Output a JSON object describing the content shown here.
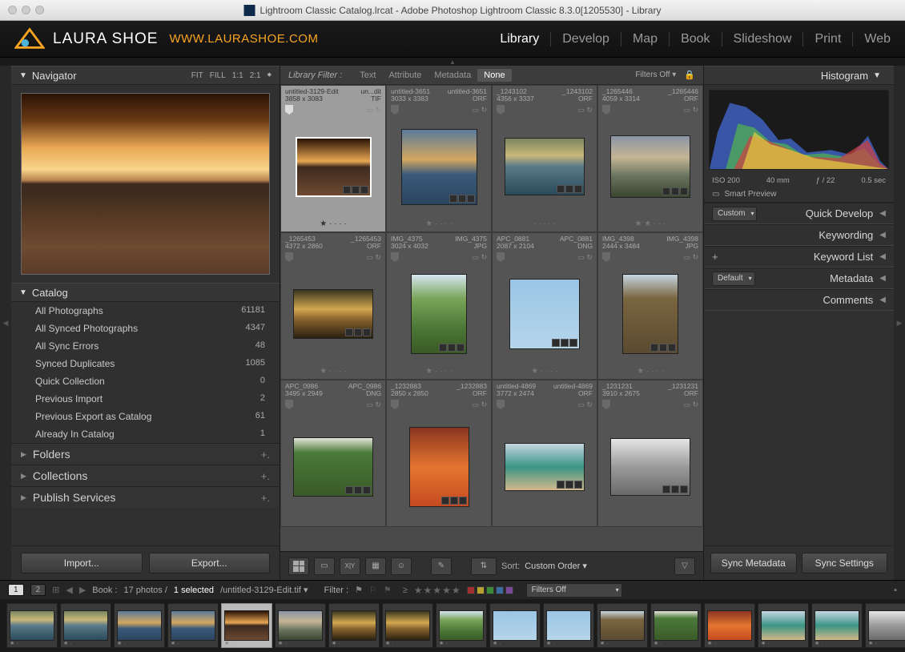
{
  "titlebar": {
    "text": "Lightroom Classic Catalog.lrcat - Adobe Photoshop Lightroom Classic 8.3.0[1205530] - Library"
  },
  "brand": {
    "name": "LAURA SHOE",
    "url": "WWW.LAURASHOE.COM"
  },
  "modules": [
    "Library",
    "Develop",
    "Map",
    "Book",
    "Slideshow",
    "Print",
    "Web"
  ],
  "active_module": "Library",
  "navigator": {
    "title": "Navigator",
    "modes": [
      "FIT",
      "FILL",
      "1:1",
      "2:1"
    ]
  },
  "catalog": {
    "title": "Catalog",
    "rows": [
      {
        "label": "All Photographs",
        "count": "61181"
      },
      {
        "label": "All Synced Photographs",
        "count": "4347"
      },
      {
        "label": "All Sync Errors",
        "count": "48"
      },
      {
        "label": "Synced Duplicates",
        "count": "1085"
      },
      {
        "label": "Quick Collection",
        "count": "0"
      },
      {
        "label": "Previous Import",
        "count": "2"
      },
      {
        "label": "Previous Export as Catalog",
        "count": "61"
      },
      {
        "label": "Already In Catalog",
        "count": "1"
      }
    ]
  },
  "sections": [
    "Folders",
    "Collections",
    "Publish Services"
  ],
  "import_btn": "Import...",
  "export_btn": "Export...",
  "filterbar": {
    "title": "Library Filter :",
    "tabs": [
      "Text",
      "Attribute",
      "Metadata",
      "None"
    ],
    "active": "None",
    "off": "Filters Off"
  },
  "grid": [
    {
      "name1": "untitled-3129-Edit",
      "name2": "un...dit",
      "dim": "3858 x 3083",
      "ext": "TIF",
      "thumb": "t1",
      "sel": true,
      "rating": 1
    },
    {
      "name1": "untitled-3651",
      "name2": "untitled-3651",
      "dim": "3033 x 3383",
      "ext": "ORF",
      "thumb": "t2",
      "rating": 1
    },
    {
      "name1": "_1243102",
      "name2": "_1243102",
      "dim": "4356 x 3337",
      "ext": "ORF",
      "thumb": "t3",
      "rating": 0
    },
    {
      "name1": "_1265446",
      "name2": "_1265446",
      "dim": "4059 x 3314",
      "ext": "ORF",
      "thumb": "t4",
      "rating": 2
    },
    {
      "name1": "_1265453",
      "name2": "_1265453",
      "dim": "4372 x 2860",
      "ext": "ORF",
      "thumb": "t5",
      "rating": 1
    },
    {
      "name1": "IMG_4375",
      "name2": "IMG_4375",
      "dim": "3024 x 4032",
      "ext": "JPG",
      "thumb": "t6",
      "rating": 1
    },
    {
      "name1": "APC_0881",
      "name2": "APC_0881",
      "dim": "2087 x 2104",
      "ext": "DNG",
      "thumb": "t7",
      "rating": 1
    },
    {
      "name1": "IMG_4398",
      "name2": "IMG_4398",
      "dim": "2444 x 3484",
      "ext": "JPG",
      "thumb": "t8",
      "rating": 1
    },
    {
      "name1": "APC_0986",
      "name2": "APC_0986",
      "dim": "3495 x 2949",
      "ext": "DNG",
      "thumb": "t9"
    },
    {
      "name1": "_1232883",
      "name2": "_1232883",
      "dim": "2850 x 2850",
      "ext": "ORF",
      "thumb": "t10"
    },
    {
      "name1": "untitled-4869",
      "name2": "untitled-4869",
      "dim": "3772 x 2474",
      "ext": "ORF",
      "thumb": "t11"
    },
    {
      "name1": "_1231231",
      "name2": "_1231231",
      "dim": "3910 x 2675",
      "ext": "ORF",
      "thumb": "t12"
    }
  ],
  "toolbar": {
    "sort_lbl": "Sort:",
    "sort_val": "Custom Order"
  },
  "right": {
    "histogram_title": "Histogram",
    "meta": {
      "iso": "ISO 200",
      "focal": "40 mm",
      "ap": "ƒ / 22",
      "sh": "0.5 sec"
    },
    "smart": "Smart Preview",
    "qd_drop": "Custom",
    "qd": "Quick Develop",
    "kw": "Keywording",
    "kl": "Keyword List",
    "md_drop": "Default",
    "md": "Metadata",
    "cm": "Comments",
    "sync_meta": "Sync Metadata",
    "sync_set": "Sync Settings"
  },
  "filmstrip_hdr": {
    "book": "Book :",
    "info": "17 photos /",
    "sel": "1 selected",
    "file": "/untitled-3129-Edit.tif",
    "filter": "Filter :",
    "off": "Filters Off"
  },
  "color_labels": [
    "#a03030",
    "#b8a030",
    "#3a8a3a",
    "#3a6aa0",
    "#7a4a9a"
  ]
}
